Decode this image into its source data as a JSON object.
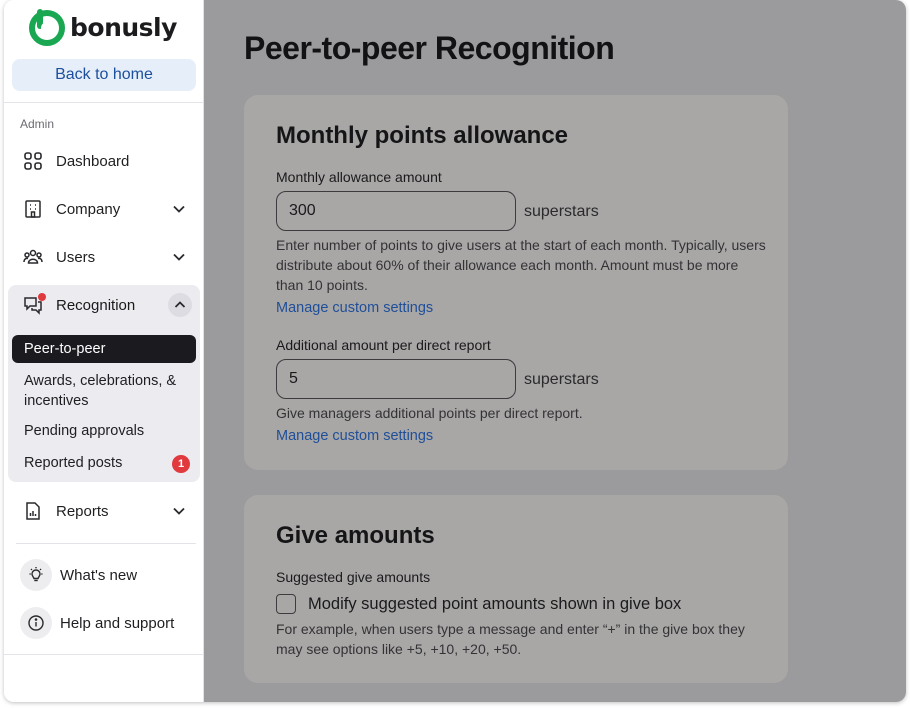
{
  "brand": {
    "name": "bonusly",
    "color": "#1aa751"
  },
  "sidebar": {
    "back_label": "Back to home",
    "section_label": "Admin",
    "items": [
      {
        "label": "Dashboard",
        "icon": "grid-icon"
      },
      {
        "label": "Company",
        "icon": "building-icon"
      },
      {
        "label": "Users",
        "icon": "users-icon"
      },
      {
        "label": "Recognition",
        "icon": "chat-bubbles-icon"
      },
      {
        "label": "Reports",
        "icon": "report-icon"
      }
    ],
    "recognition_sub": [
      {
        "label": "Peer-to-peer"
      },
      {
        "label": "Awards, celebrations, & incentives"
      },
      {
        "label": "Pending approvals"
      },
      {
        "label": "Reported posts",
        "badge": "1"
      }
    ],
    "footer": [
      {
        "label": "What's new",
        "icon": "lightbulb-icon"
      },
      {
        "label": "Help and support",
        "icon": "info-icon"
      }
    ]
  },
  "main": {
    "title": "Peer-to-peer Recognition",
    "allowance_card": {
      "title": "Monthly points allowance",
      "monthly_label": "Monthly allowance amount",
      "monthly_value": "300",
      "unit": "superstars",
      "monthly_help": "Enter number of points to give users at the start of each month. Typically, users distribute about 60% of their allowance each month. Amount must be more than 10 points.",
      "manage_link": "Manage custom settings",
      "additional_label": "Additional amount per direct report",
      "additional_value": "5",
      "additional_help": "Give managers additional points per direct report."
    },
    "give_card": {
      "title": "Give amounts",
      "suggested_label": "Suggested give amounts",
      "checkbox_label": "Modify suggested point amounts shown in give box",
      "help": "For example, when users type a message and enter “+” in the give box they may see options like +5, +10, +20, +50."
    }
  }
}
